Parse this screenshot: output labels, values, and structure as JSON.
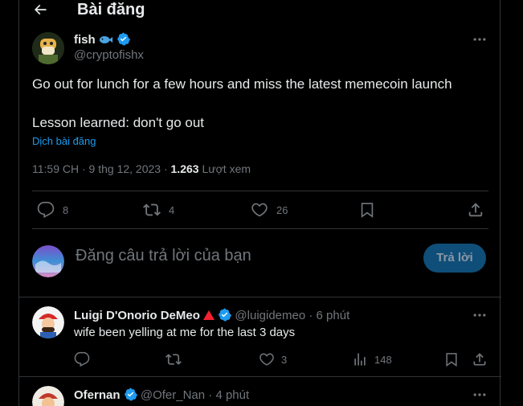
{
  "header": {
    "title": "Bài đăng"
  },
  "tweet": {
    "author_name": "fish",
    "author_handle": "@cryptofishx",
    "line1": "Go out for lunch for a few hours and miss the latest memecoin launch",
    "line2": "Lesson learned: don't go out",
    "translate": "Dịch bài đăng",
    "time": "11:59 CH · 9 thg 12, 2023 · ",
    "views_count": "1.263",
    "views_label": " Lượt xem",
    "stats": {
      "replies": "8",
      "retweets": "4",
      "likes": "26"
    }
  },
  "compose": {
    "placeholder": "Đăng câu trả lời của bạn",
    "button": "Trả lời"
  },
  "replies": [
    {
      "name": "Luigi D'Onorio DeMeo",
      "handle": "@luigidemeo",
      "time": " · 6 phút",
      "text": "wife been yelling at me for the last 3 days",
      "likes": "3",
      "views": "148"
    },
    {
      "name": "Ofernan",
      "handle": "@Ofer_Nan",
      "time": " · 4 phút"
    }
  ],
  "colors": {
    "accent": "#1d9bf0",
    "border": "#2f3336",
    "muted": "#71767b",
    "button": "#0f4e78"
  },
  "icons": [
    "back-arrow-icon",
    "fish-emoji-icon",
    "verified-icon",
    "more-icon",
    "reply-icon",
    "retweet-icon",
    "like-icon",
    "bookmark-icon",
    "share-icon",
    "views-icon",
    "red-triangle-icon"
  ]
}
